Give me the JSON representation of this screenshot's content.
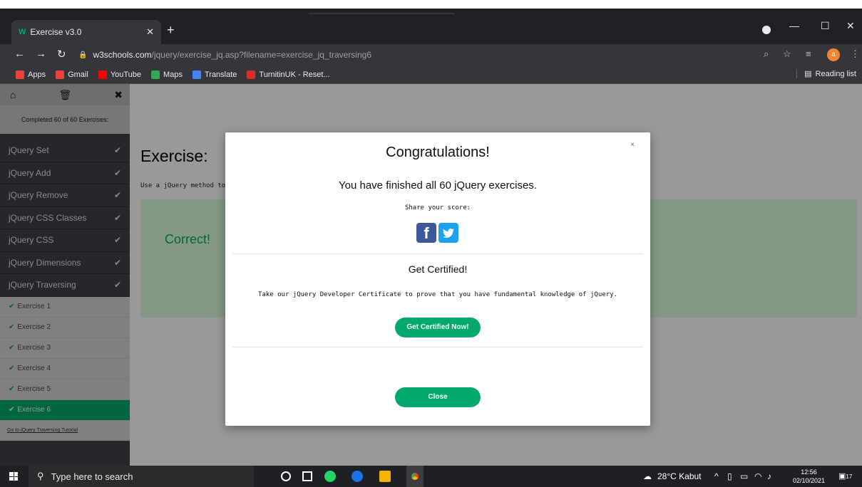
{
  "browser": {
    "tab_title": "Exercise v3.0",
    "favicon": "W",
    "url_host": "w3schools.com",
    "url_path": "/jquery/exercise_jq.asp?filename=exercise_jq_traversing6",
    "profile_initial": "a",
    "bookmarks": [
      {
        "label": "Apps",
        "color": "#ea4335"
      },
      {
        "label": "Gmail",
        "color": "#ea4335"
      },
      {
        "label": "YouTube",
        "color": "#ff0000"
      },
      {
        "label": "Maps",
        "color": "#34a853"
      },
      {
        "label": "Translate",
        "color": "#4285f4"
      },
      {
        "label": "TurnitinUK - Reset...",
        "color": "#d93025"
      }
    ],
    "reading_list": "Reading list"
  },
  "sidebar": {
    "progress": "Completed 60 of 60 Exercises:",
    "topics": [
      "jQuery Set",
      "jQuery Add",
      "jQuery Remove",
      "jQuery CSS Classes",
      "jQuery CSS",
      "jQuery Dimensions",
      "jQuery Traversing"
    ],
    "exercises": [
      "Exercise 1",
      "Exercise 2",
      "Exercise 3",
      "Exercise 4",
      "Exercise 5",
      "Exercise 6"
    ],
    "tutorial_link": "Go to jQuery Traversing Tutorial"
  },
  "main": {
    "title": "Exercise:",
    "description": "Use a jQuery method to",
    "correct": "Correct!"
  },
  "modal": {
    "close_x": "×",
    "title": "Congratulations!",
    "finished": "You have finished all 60 jQuery exercises.",
    "share": "Share your score:",
    "certified_heading": "Get Certified!",
    "certified_text": "Take our jQuery Developer Certificate to prove that you have fundamental knowledge of jQuery.",
    "cert_button": "Get Certified Now!",
    "close_button": "Close"
  },
  "taskbar": {
    "search_placeholder": "Type here to search",
    "weather": "28°C  Kabut",
    "time": "12:56",
    "date": "02/10/2021",
    "notifications": "17"
  },
  "colors": {
    "accent": "#04aa6d",
    "facebook": "#3b5998",
    "twitter": "#1da1f2"
  }
}
